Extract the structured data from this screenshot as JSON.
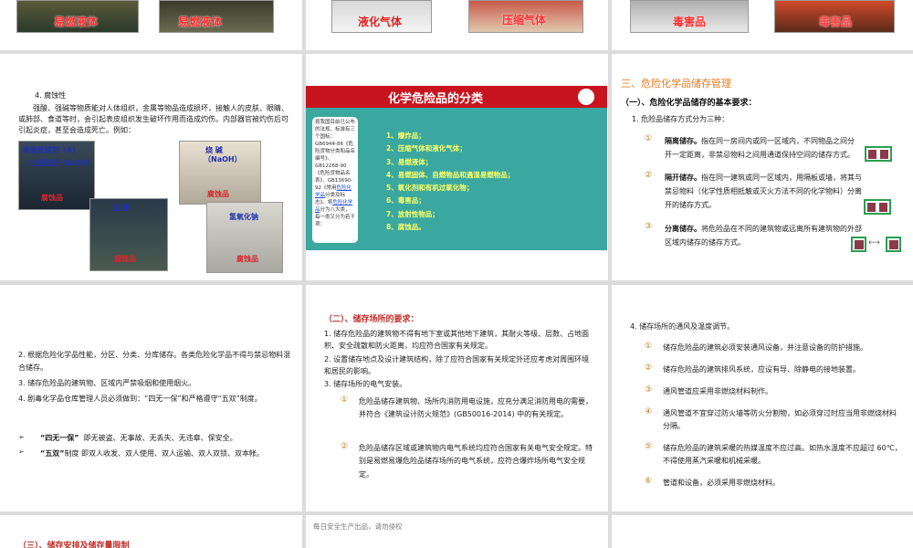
{
  "top_row": {
    "labels": [
      "易燃液体",
      "易燃液体",
      "液化气体",
      "压缩气体",
      "毒害品",
      "毒害品"
    ]
  },
  "slide_corrosive": {
    "heading": "4. 腐蚀性",
    "body": "强酸、强碱等物质能对人体组织，金属等物品造成损坏，接触人的皮肤、眼睛、或肺部、食道等时，会引起表皮组织发生破坏作用而造成灼伤。内部器官被灼伤后可引起炎症，甚至会造成死亡。例如：",
    "img1_label1": "表面处理剂（A）",
    "img1_label2": "（主要成分 NaOH）",
    "img1_label3": "腐蚀品",
    "img2_label1": "烧 碱",
    "img2_label2": "（NaOH）",
    "img2_label3": "腐蚀品",
    "img3_label1": "盐 酸",
    "img3_label2": "腐蚀品",
    "img4_label1": "氢氧化钠",
    "img4_label2": "腐蚀品"
  },
  "slide_classify": {
    "title": "化学危险品的分类",
    "left_text_a": "按我国目前已公布的法规、标准有三个国标：GB6944-86《危险货物分类和品名编号》、GB12268-90《危险货物品名表》、GB13690-92《常用",
    "left_link1": "危险化学品",
    "left_text_b": "分类及标志》。将",
    "left_link2": "危险化学品",
    "left_text_c": "分为八大类，每一类又分为若干项：",
    "items": [
      "1、爆炸品；",
      "2、压缩气体和液化气体；",
      "3、易燃液体；",
      "4、易燃固体、自燃物品和遇湿易燃物品；",
      "5、氧化剂和有机过氧化物；",
      "6、毒害品；",
      "7、放射性物品；",
      "8、腐蚀品。"
    ]
  },
  "slide_storage": {
    "title": "三、危险化学品储存管理",
    "subtitle": "（一）、危险化学品储存的基本要求：",
    "intro": "1. 危险品储存方式分为三种：",
    "items": [
      {
        "num": "①",
        "bold": "隔离储存。",
        "text": "指在同一房间内或同一区域内，不同物品之间分开一定距离，非禁忌物料之间用通道保持空间的储存方式。"
      },
      {
        "num": "②",
        "bold": "隔开储存。",
        "text": "指在同一建筑或同一区域内，用隔板或墙，将其与禁忌物料（化学性质相抵触或灭火方法不同的化学物料）分离开的储存方式。"
      },
      {
        "num": "③",
        "bold": "分离储存。",
        "text": "将危险品在不同的建筑物或远离所有建筑物的外部区域内储存的储存方式。"
      }
    ]
  },
  "slide_rules": {
    "p2": "2. 根据危险化学品性能，分区、分类、分库储存。各类危险化学品不得与禁忌物料混合储存。",
    "p3": "3. 储存危险品的建筑物、区域内严禁吸烟和使用烟火。",
    "p4": "4. 剧毒化学品仓库管理人员必须做到：“四无一保”和严格遵守“五双”制度。",
    "b1_bold": "“四无一保”",
    "b1_text": "即无被盗、无事故、无丢失、无违章、保安全。",
    "b2_bold": "“五双”",
    "b2_text": "制度  即双人收发、双人使用、双人运输、双人双锁、双本帐。"
  },
  "slide_site": {
    "title": "（二）、储存场所的要求：",
    "p1": "1. 储存危险品的建筑物不得有地下室或其他地下建筑，其耐火等级、层数、占地面积、安全疏散和防火距离，均应符合国家有关规定。",
    "p2": "2. 设置储存地点及设计建筑结构，除了应符合国家有关规定外还应考虑对周围环境和居民的影响。",
    "p3": "3. 储存场所的电气安装。",
    "sub1_num": "①",
    "sub1": "危险品储存建筑物、场所内消防用电设施，应充分满足消防用电的需要，并符合《建筑设计防火规范》(GB50016-2014) 中的有关规定。",
    "sub2_num": "②",
    "sub2": "危险品储存区域或建筑物内电气系统均应符合国家有关电气安全规定。特别是易燃易爆危险品储存场所的电气系统，应符合爆炸场所电气安全规定。"
  },
  "slide_vent": {
    "heading": "4. 储存场所的通风及温度调节。",
    "items": [
      {
        "num": "①",
        "text": "储存危险品的建筑必须安装通风设备，并注意设备的防护措施。"
      },
      {
        "num": "②",
        "text": "储存危险品的建筑排风系统，应设有导、除静电的接地装置。"
      },
      {
        "num": "③",
        "text": "通风管道应采用非燃烧材料制作。"
      },
      {
        "num": "④",
        "text": "通风管道不宜穿过防火墙等防火分割物，如必须穿过时应当用非燃烧材料分隔。"
      },
      {
        "num": "⑤",
        "text": "储存危险品的建筑采暖的热媒温度不应过高。如热水温度不应超过 60℃，不得使用蒸汽采暖和机械采暖。"
      },
      {
        "num": "⑥",
        "text": "管道和设备，必须采用非燃烧材料。"
      }
    ]
  },
  "bottom": {
    "left_title": "（三）、储存安排及储存量限制",
    "footer": "每日安全生产出品，请勿侵权"
  },
  "colors": {
    "title_red": "#d0202a",
    "title_orange": "#e87a1e",
    "green_item": "#1c9a2a",
    "square_border": "#2aa050"
  }
}
